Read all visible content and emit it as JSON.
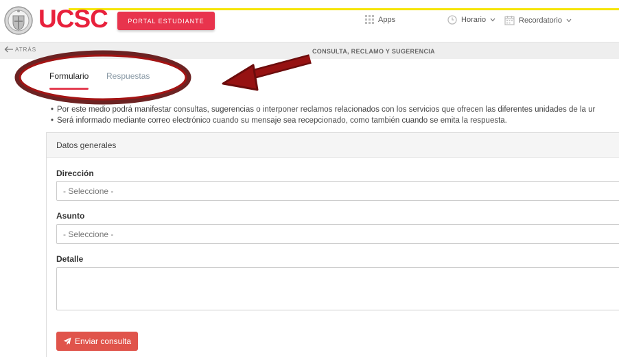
{
  "colors": {
    "brand": "#e8213c",
    "portal_button": "#e8344d",
    "accent_tab": "#e33c50",
    "send_button": "#e0544b",
    "annotation": "#8b1010"
  },
  "header": {
    "brand_name": "UCSC",
    "logo_icon": "university-crest-icon",
    "portal_button_label": "PORTAL ESTUDIANTE",
    "apps": {
      "label": "Apps",
      "icon": "grid-icon"
    },
    "schedule": {
      "label": "Horario",
      "icon": "clock-icon",
      "caret": "chevron-down-icon"
    },
    "reminder": {
      "label": "Recordatorio",
      "icon": "calendar-icon",
      "caret": "chevron-down-icon"
    }
  },
  "subheader": {
    "back_label": "ATRÁS",
    "back_icon": "arrow-left-icon",
    "title": "CONSULTA, RECLAMO Y SUGERENCIA"
  },
  "tabs": [
    {
      "label": "Formulario",
      "active": true
    },
    {
      "label": "Respuestas",
      "active": false
    }
  ],
  "notes": [
    "Por este medio podrá manifestar consultas, sugerencias o interponer reclamos relacionados con los servicios que ofrecen las diferentes unidades de la ur",
    "Será informado mediante correo electrónico cuando su mensaje sea recepcionado, como también cuando se emita la respuesta."
  ],
  "form": {
    "panel_title": "Datos generales",
    "direccion": {
      "label": "Dirección",
      "value": "- Seleccione -"
    },
    "asunto": {
      "label": "Asunto",
      "value": "- Seleccione -"
    },
    "detalle": {
      "label": "Detalle",
      "value": ""
    },
    "submit": {
      "label": "Enviar consulta",
      "icon": "paper-plane-icon"
    }
  }
}
